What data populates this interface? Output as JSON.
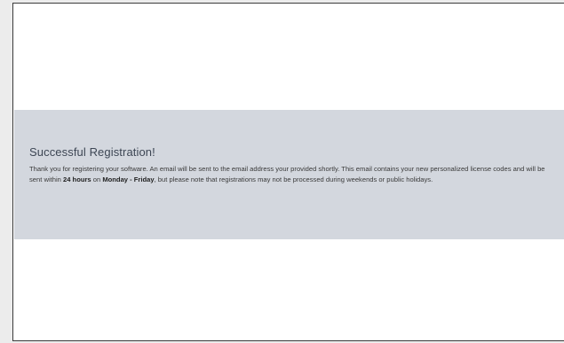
{
  "message": {
    "title": "Successful Registration!",
    "body_part1": "Thank you for registering your software. An email will be sent to the email address your provided shortly. This email contains your new personalized license codes and will be sent within ",
    "highlight_hours": "24 hours",
    "body_part2": " on ",
    "highlight_days": "Monday - Friday",
    "body_part3": ", but please note that registrations may not be processed during weekends or public holidays."
  }
}
